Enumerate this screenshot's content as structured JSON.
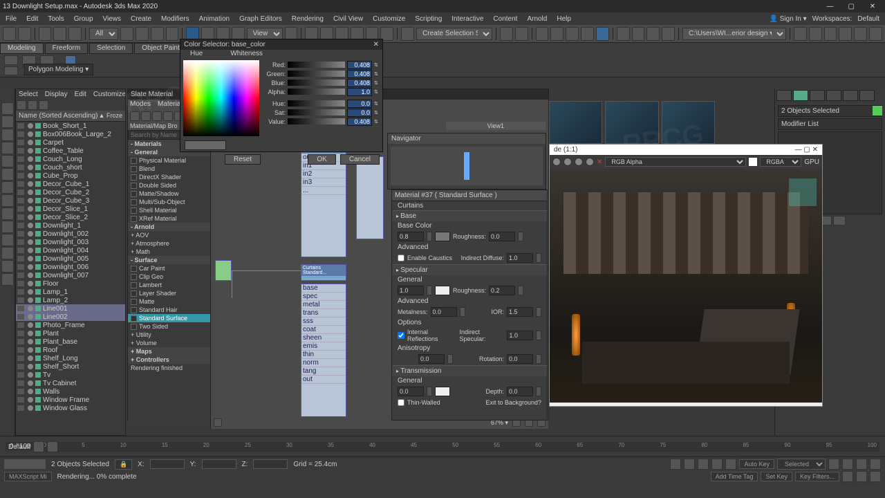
{
  "title": "13 Downlight Setup.max - Autodesk 3ds Max 2020",
  "menus": [
    "File",
    "Edit",
    "Tools",
    "Group",
    "Views",
    "Create",
    "Modifiers",
    "Animation",
    "Graph Editors",
    "Rendering",
    "Civil View",
    "Customize",
    "Scripting",
    "Interactive",
    "Content",
    "Arnold",
    "Help"
  ],
  "signin": "Sign In",
  "workspaces_lbl": "Workspaces:",
  "workspaces_val": "Default",
  "toolbar_all": "All",
  "toolbar_view": "View",
  "toolbar_sel": "Create Selection Se",
  "toolbar_path": "C:\\Users\\WI...erior design ▾",
  "ribbon": {
    "tabs": [
      "Modeling",
      "Freeform",
      "Selection",
      "Object Paint"
    ],
    "poly": "Polygon Modeling ▾"
  },
  "scene": {
    "tabs": [
      "Select",
      "Display",
      "Edit",
      "Customize"
    ],
    "header": "Name (Sorted Ascending)",
    "header2": "▲ Froze",
    "items": [
      "Book_Short_1",
      "Box006Book_Large_2",
      "Carpet",
      "Coffee_Table",
      "Couch_Long",
      "Couch_short",
      "Cube_Prop",
      "Decor_Cube_1",
      "Decor_Cube_2",
      "Decor_Cube_3",
      "Decor_Slice_1",
      "Decor_Slice_2",
      "Downlight_1",
      "Downlight_002",
      "Downlight_003",
      "Downlight_004",
      "Downlight_005",
      "Downlight_006",
      "Downlight_007",
      "Floor",
      "Lamp_1",
      "Lamp_2",
      "Line001",
      "Line002",
      "Photo_Frame",
      "Plant",
      "Plant_base",
      "Roof",
      "Shelf_Long",
      "Shelf_Short",
      "Tv",
      "Tv Cabinet",
      "Walls",
      "Window Frame",
      "Window Glass"
    ],
    "selected": [
      "Line001",
      "Line002"
    ]
  },
  "slate": {
    "title": "Slate Material",
    "menu": [
      "Modes",
      "Material"
    ],
    "browser_title": "Material/Map Bro",
    "search_ph": "Search by Name",
    "cats": [
      {
        "t": "hdr",
        "l": "- Materials"
      },
      {
        "t": "hdr",
        "l": "- General"
      },
      {
        "t": "mat",
        "l": "Physical Material"
      },
      {
        "t": "mat",
        "l": "Blend"
      },
      {
        "t": "mat",
        "l": "DirectX Shader"
      },
      {
        "t": "mat",
        "l": "Double Sided"
      },
      {
        "t": "mat",
        "l": "Matte/Shadow"
      },
      {
        "t": "mat",
        "l": "Multi/Sub-Object"
      },
      {
        "t": "mat",
        "l": "Shell Material"
      },
      {
        "t": "mat",
        "l": "XRef Material"
      },
      {
        "t": "hdr",
        "l": "- Arnold"
      },
      {
        "t": "lnk",
        "l": "+ AOV"
      },
      {
        "t": "lnk",
        "l": "+ Atmosphere"
      },
      {
        "t": "lnk",
        "l": "+ Math"
      },
      {
        "t": "hdr",
        "l": "- Surface"
      },
      {
        "t": "mat",
        "l": "Car Paint"
      },
      {
        "t": "mat",
        "l": "Clip Geo"
      },
      {
        "t": "mat",
        "l": "Lambert"
      },
      {
        "t": "mat",
        "l": "Layer Shader"
      },
      {
        "t": "mat",
        "l": "Matte"
      },
      {
        "t": "mat",
        "l": "Standard Hair"
      },
      {
        "t": "sel",
        "l": "Standard Surface"
      },
      {
        "t": "mat",
        "l": "Two Sided"
      },
      {
        "t": "lnk",
        "l": "+ Utility"
      },
      {
        "t": "lnk",
        "l": "+ Volume"
      },
      {
        "t": "hdr",
        "l": "+ Maps"
      },
      {
        "t": "hdr",
        "l": "+ Controllers"
      },
      {
        "t": "stat",
        "l": "Rendering finished"
      }
    ],
    "view_tab": "View1",
    "node_title": "Curtains Standard...",
    "zoom": "67% ▾"
  },
  "colorsel": {
    "title": "Color Selector: base_color",
    "hue_lbl": "Hue",
    "white_lbl": "Whiteness",
    "rows": [
      {
        "l": "Red:",
        "v": "0.408"
      },
      {
        "l": "Green:",
        "v": "0.408"
      },
      {
        "l": "Blue:",
        "v": "0.408"
      },
      {
        "l": "Alpha:",
        "v": "1.0"
      },
      {
        "l": "Hue:",
        "v": "0.0"
      },
      {
        "l": "Sat:",
        "v": "0.0"
      },
      {
        "l": "Value:",
        "v": "0.408"
      }
    ],
    "reset": "Reset",
    "ok": "OK",
    "cancel": "Cancel"
  },
  "navigator": {
    "title": "Navigator"
  },
  "params": {
    "title": "Material #37 ( Standard Surface )",
    "name": "Curtains",
    "sections": {
      "base": "Base",
      "basecolor": "Base Color",
      "base_w": "0.8",
      "rough_l": "Roughness:",
      "rough_v": "0.0",
      "adv": "Advanced",
      "caustics": "Enable Caustics",
      "indiff_l": "Indirect Diffuse:",
      "indiff_v": "1.0",
      "spec": "Specular",
      "general": "General",
      "spec_w": "1.0",
      "srough_v": "0.2",
      "metal_l": "Metalness:",
      "metal_v": "0.0",
      "ior_l": "IOR:",
      "ior_v": "1.5",
      "opts": "Options",
      "intref": "Internal Reflections",
      "indspec_l": "Indirect Specular:",
      "indspec_v": "1.0",
      "aniso": "Anisotropy",
      "aniso_v": "0.0",
      "rot_l": "Rotation:",
      "rot_v": "0.0",
      "trans": "Transmission",
      "trans_w": "0.0",
      "depth_l": "Depth:",
      "depth_v": "0.0",
      "thin": "Thin-Walled",
      "exit": "Exit to Background?"
    }
  },
  "render": {
    "title": "de (1:1)",
    "alpha": "RGB Alpha",
    "rgba": "RGBA",
    "gpu": "GPU"
  },
  "cmd": {
    "sel_count": "2 Objects Selected",
    "modlist": "Modifier List"
  },
  "timeline": {
    "frame": "0 / 100",
    "ticks": [
      "0",
      "5",
      "10",
      "15",
      "20",
      "25",
      "30",
      "35",
      "40",
      "45",
      "50",
      "55",
      "60",
      "65",
      "70",
      "75",
      "80",
      "85",
      "90",
      "95",
      "100"
    ]
  },
  "status": {
    "sel": "2 Objects Selected",
    "render": "Rendering... 0% complete",
    "default": "Default",
    "script": "MAXScript Mi",
    "grid": "Grid = 25.4cm",
    "autokey": "Auto Key",
    "setkey": "Set Key",
    "selected": "Selected",
    "keyfilt": "Key Filters...",
    "addtime": "Add Time Tag",
    "x": "X:",
    "y": "Y:",
    "z": "Z:"
  }
}
